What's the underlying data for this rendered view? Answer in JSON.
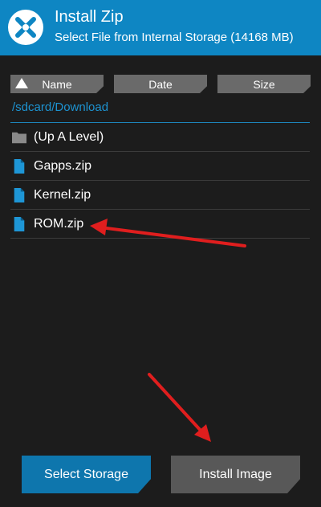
{
  "colors": {
    "header_bg": "#0e86c3",
    "background": "#1c1c1c",
    "path_text": "#1d93d1",
    "sort_button": "#6a6a6a",
    "file_icon": "#1e96d6",
    "folder_icon": "#8a8a8a",
    "primary_button": "#0e76ad",
    "secondary_button": "#585858",
    "annotation_arrow": "#e01e1e"
  },
  "header": {
    "logo_icon": "twrp-logo-icon",
    "title": "Install Zip",
    "subtitle": "Select File from Internal Storage (14168 MB)"
  },
  "sort": {
    "name_label": "Name",
    "date_label": "Date",
    "size_label": "Size",
    "active_sort_icon": "sort-ascending-triangle-icon"
  },
  "path": "/sdcard/Download",
  "files": [
    {
      "label": "(Up A Level)",
      "icon": "folder-icon"
    },
    {
      "label": "Gapps.zip",
      "icon": "file-icon"
    },
    {
      "label": "Kernel.zip",
      "icon": "file-icon"
    },
    {
      "label": "ROM.zip",
      "icon": "file-icon"
    }
  ],
  "buttons": {
    "select_storage": "Select Storage",
    "install_image": "Install Image"
  },
  "annotations": {
    "arrow_icon": "red-arrow-icon",
    "targets": [
      "ROM.zip",
      "Install Image"
    ]
  }
}
